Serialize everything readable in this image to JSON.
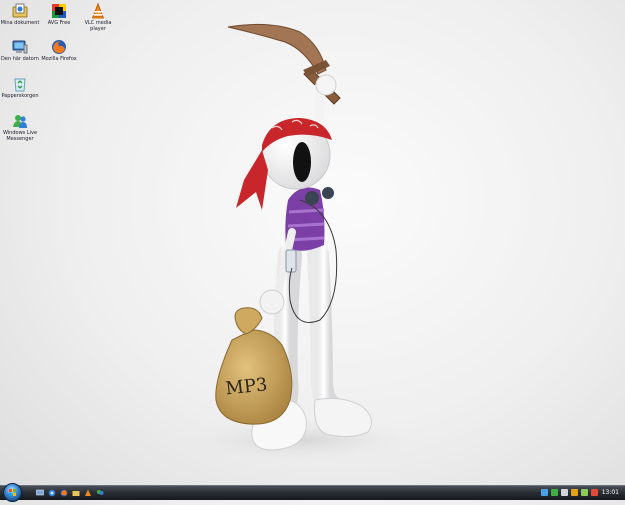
{
  "desktop_icons": [
    {
      "label": "Mina dokument",
      "icon": "documents-folder-icon"
    },
    {
      "label": "AVG Free",
      "icon": "avg-antivirus-icon"
    },
    {
      "label": "VLC media player",
      "icon": "vlc-cone-icon"
    },
    {
      "label": "Den här datorn",
      "icon": "computer-icon"
    },
    {
      "label": "Mozilla Firefox",
      "icon": "firefox-icon"
    },
    {
      "label": "Papperskorgen",
      "icon": "recycle-bin-icon"
    },
    {
      "label": "Windows Live Messenger",
      "icon": "messenger-icon"
    }
  ],
  "wallpaper": {
    "bag_text": "MP3"
  },
  "taskbar": {
    "quick_launch": [
      "show-desktop-icon",
      "ie-icon",
      "firefox-icon",
      "folder-icon",
      "vlc-icon",
      "messenger-icon"
    ],
    "tray_icons": [
      "network-icon",
      "messenger-tray-icon",
      "volume-icon",
      "avg-tray-icon",
      "battery-icon",
      "flag-icon"
    ],
    "clock": "13:01"
  },
  "colors": {
    "bandana_red": "#c8262a",
    "shirt_purple": "#7b3fa6",
    "sword_brown": "#a27654",
    "bag_tan": "#c9a45d"
  }
}
